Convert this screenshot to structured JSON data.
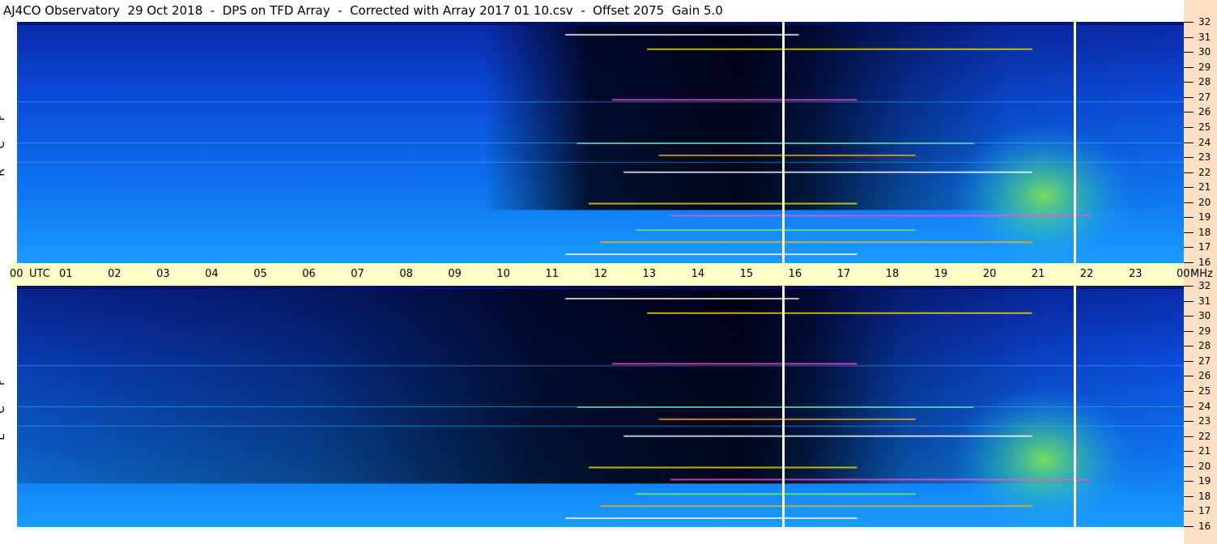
{
  "title": "AJ4CO Observatory  29 Oct 2018  -  DPS on TFD Array  -  Corrected with Array 2017 01 10.csv  -  Offset 2075  Gain 5.0",
  "panels": {
    "top": {
      "label_letters": [
        "R",
        "C",
        "P"
      ]
    },
    "bottom": {
      "label_letters": [
        "L",
        "C",
        "P"
      ]
    }
  },
  "time_axis": {
    "unit_label": "UTC",
    "labels": [
      "00",
      "01",
      "02",
      "03",
      "04",
      "05",
      "06",
      "07",
      "08",
      "09",
      "10",
      "11",
      "12",
      "13",
      "14",
      "15",
      "16",
      "17",
      "18",
      "19",
      "20",
      "21",
      "22",
      "23",
      "00"
    ]
  },
  "freq_axis": {
    "unit_label": "MHz",
    "labels": [
      "32",
      "31",
      "30",
      "29",
      "28",
      "27",
      "26",
      "25",
      "24",
      "23",
      "22",
      "21",
      "20",
      "19",
      "18",
      "17",
      "16"
    ]
  },
  "chart_data": {
    "type": "heatmap",
    "title": "AJ4CO Observatory  29 Oct 2018  -  DPS on TFD Array  -  Corrected with Array 2017 01 10.csv  -  Offset 2075  Gain 5.0",
    "x_axis": {
      "label": "UTC",
      "range": [
        0,
        24
      ],
      "unit": "hours"
    },
    "y_axis": {
      "label": "MHz",
      "range": [
        16,
        32
      ]
    },
    "panels": [
      "R C P",
      "L C P"
    ],
    "markers_utc": [
      15.75,
      21.75
    ],
    "colors": {
      "low": "#000000",
      "mid": "#0a3fd8",
      "high": "#2ab0ff",
      "activity": "#7cf05a",
      "hot": "#ffe600"
    }
  }
}
